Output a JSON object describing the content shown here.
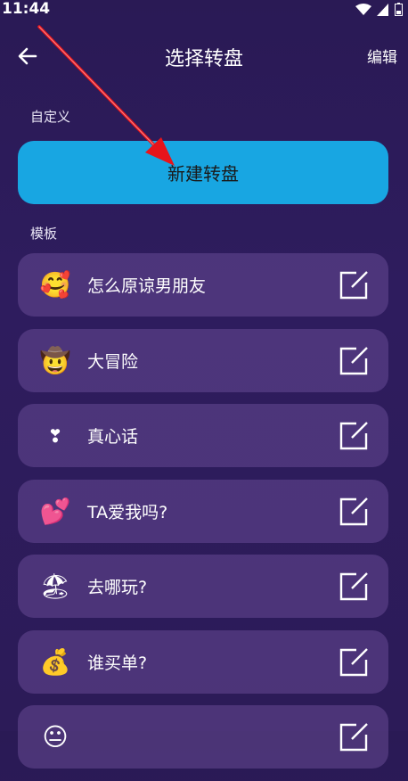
{
  "status": {
    "time": "11:44"
  },
  "header": {
    "title": "选择转盘",
    "edit_label": "编辑"
  },
  "custom": {
    "section_label": "自定义",
    "new_button_label": "新建转盘"
  },
  "templates": {
    "section_label": "模板",
    "items": [
      {
        "emoji": "🥰",
        "label": "怎么原谅男朋友"
      },
      {
        "emoji": "🤠",
        "label": "大冒险"
      },
      {
        "emoji": "❣",
        "label": "真心话"
      },
      {
        "emoji": "💕",
        "label": "TA爱我吗?"
      },
      {
        "emoji": "🏖",
        "label": "去哪玩?"
      },
      {
        "emoji": "💰",
        "label": "谁买单?"
      },
      {
        "emoji": "😐",
        "label": ""
      }
    ]
  },
  "colors": {
    "accent": "#18a6e2",
    "annotation_arrow": "#e8141b"
  }
}
